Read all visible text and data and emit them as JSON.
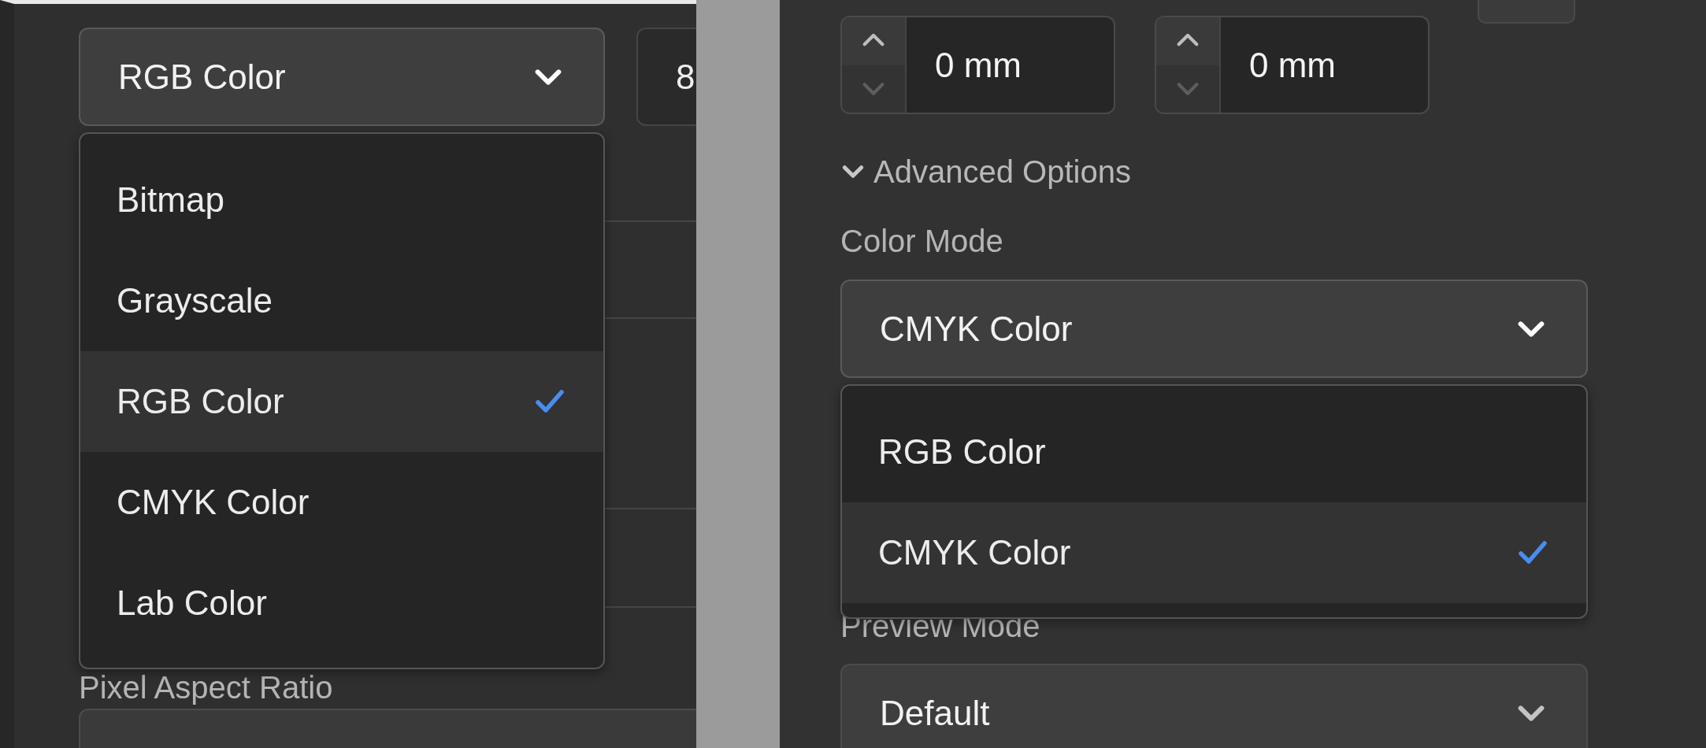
{
  "left_panel": {
    "color_mode_select": {
      "value": "RGB Color",
      "expanded": true,
      "options": [
        {
          "label": "Bitmap",
          "selected": false
        },
        {
          "label": "Grayscale",
          "selected": false
        },
        {
          "label": "RGB Color",
          "selected": true
        },
        {
          "label": "CMYK Color",
          "selected": false
        },
        {
          "label": "Lab Color",
          "selected": false
        }
      ]
    },
    "bit_depth_field": {
      "value": "8"
    },
    "pixel_aspect_ratio": {
      "label": "Pixel Aspect Ratio"
    }
  },
  "right_panel": {
    "offset_fields": [
      {
        "value": "0 mm"
      },
      {
        "value": "0 mm"
      }
    ],
    "advanced_options": {
      "label": "Advanced Options",
      "expanded": true
    },
    "color_mode": {
      "label": "Color Mode",
      "select": {
        "value": "CMYK Color",
        "expanded": true,
        "options": [
          {
            "label": "RGB Color",
            "selected": false
          },
          {
            "label": "CMYK Color",
            "selected": true
          }
        ]
      }
    },
    "preview_mode": {
      "label": "Preview Mode",
      "select": {
        "value": "Default",
        "expanded": false
      }
    }
  }
}
